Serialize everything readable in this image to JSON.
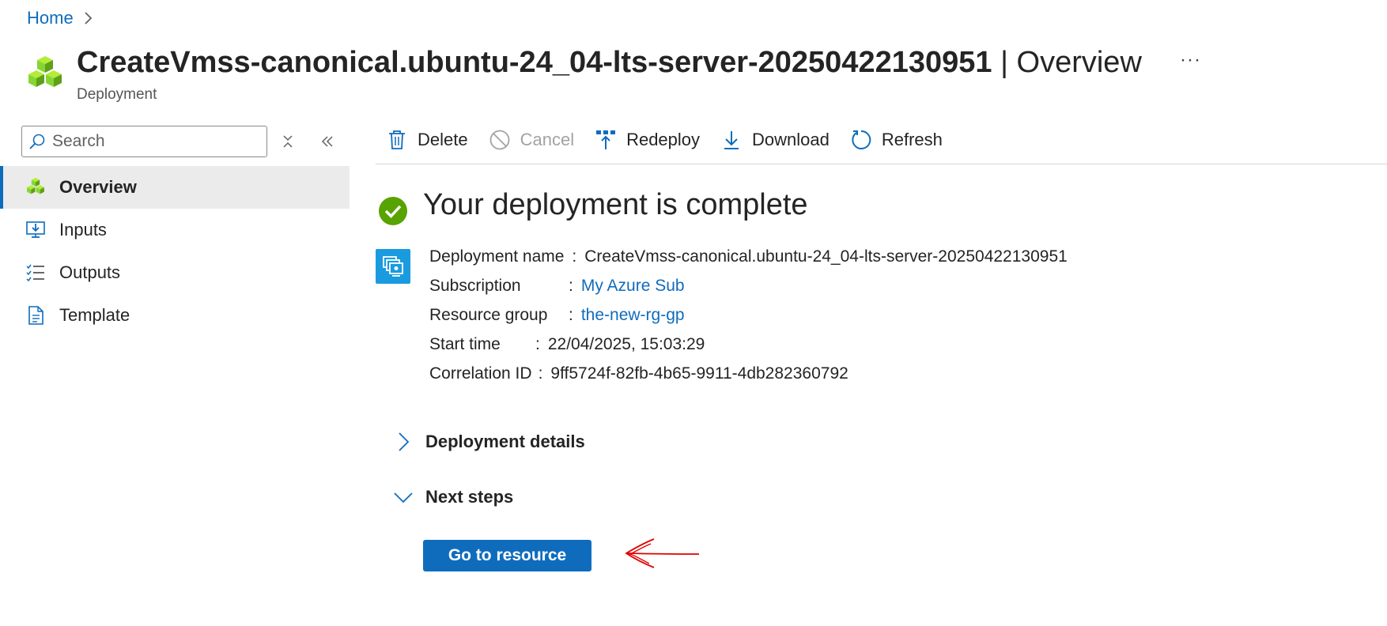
{
  "breadcrumb": {
    "home": "Home"
  },
  "header": {
    "title": "CreateVmss-canonical.ubuntu-24_04-lts-server-20250422130951",
    "separator": "|",
    "title_suffix": "Overview",
    "subtitle": "Deployment",
    "more_label": "···"
  },
  "search": {
    "placeholder": "Search"
  },
  "sidebar": {
    "items": [
      {
        "label": "Overview",
        "icon": "cubes-icon",
        "active": true
      },
      {
        "label": "Inputs",
        "icon": "monitor-download-icon"
      },
      {
        "label": "Outputs",
        "icon": "checklist-icon"
      },
      {
        "label": "Template",
        "icon": "document-icon"
      }
    ]
  },
  "toolbar": {
    "delete": "Delete",
    "cancel": "Cancel",
    "redeploy": "Redeploy",
    "download": "Download",
    "refresh": "Refresh"
  },
  "status": {
    "title": "Your deployment is complete"
  },
  "details": {
    "deployment_name_label": "Deployment name",
    "deployment_name": "CreateVmss-canonical.ubuntu-24_04-lts-server-20250422130951",
    "subscription_label": "Subscription",
    "subscription": "My Azure Sub",
    "resource_group_label": "Resource group",
    "resource_group": "the-new-rg-gp",
    "start_time_label": "Start time",
    "start_time": "22/04/2025, 15:03:29",
    "correlation_label": "Correlation ID",
    "correlation_id": "9ff5724f-82fb-4b65-9911-4db282360792",
    "colon": ":"
  },
  "sections": {
    "deployment_details": "Deployment details",
    "next_steps": "Next steps"
  },
  "actions": {
    "go_to_resource": "Go to resource"
  },
  "colors": {
    "accent": "#0f6cbd",
    "success": "#57a300",
    "annotation": "#e00000"
  }
}
